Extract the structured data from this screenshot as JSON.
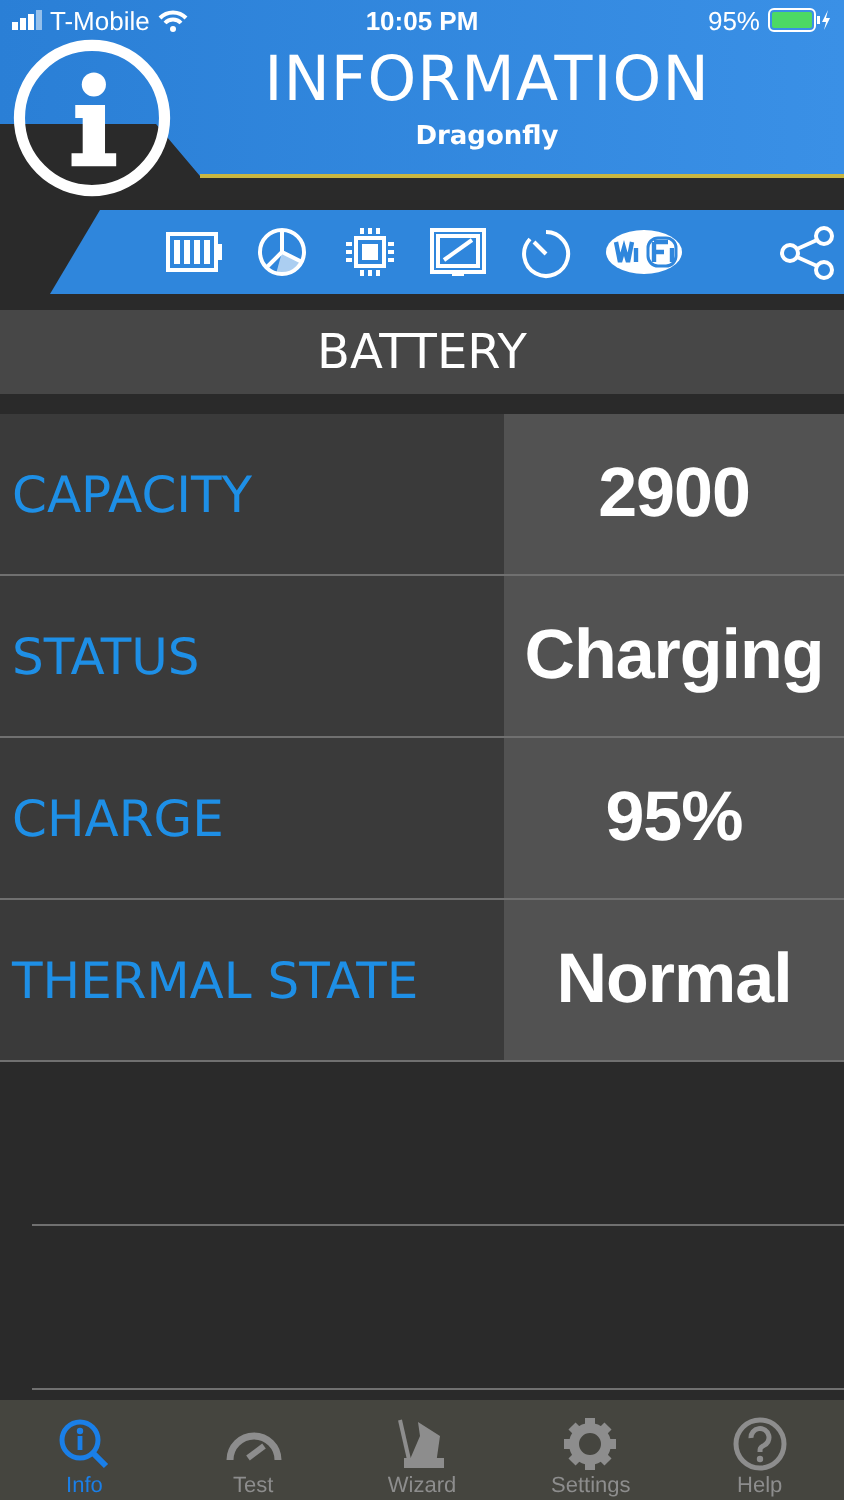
{
  "status_bar": {
    "carrier": "T-Mobile",
    "time": "10:05 PM",
    "battery": "95%"
  },
  "header": {
    "title": "INFORMATION",
    "subtitle": "Dragonfly"
  },
  "toolbar": [
    {
      "kind": "battery"
    },
    {
      "kind": "pie"
    },
    {
      "kind": "chip"
    },
    {
      "kind": "screen"
    },
    {
      "kind": "timer"
    },
    {
      "kind": "wifi"
    },
    {
      "kind": "share"
    }
  ],
  "section": {
    "title": "BATTERY"
  },
  "rows": [
    {
      "label": "CAPACITY",
      "value": "2900"
    },
    {
      "label": "STATUS",
      "value": "Charging"
    },
    {
      "label": "CHARGE",
      "value": "95%"
    },
    {
      "label": "THERMAL STATE",
      "value": "Normal"
    }
  ],
  "tabs": [
    {
      "label": "Info",
      "kind": "info",
      "selected": true
    },
    {
      "label": "Test",
      "kind": "gauge",
      "selected": false
    },
    {
      "label": "Wizard",
      "kind": "hat",
      "selected": false
    },
    {
      "label": "Settings",
      "kind": "gear",
      "selected": false
    },
    {
      "label": "Help",
      "kind": "help",
      "selected": false
    }
  ]
}
